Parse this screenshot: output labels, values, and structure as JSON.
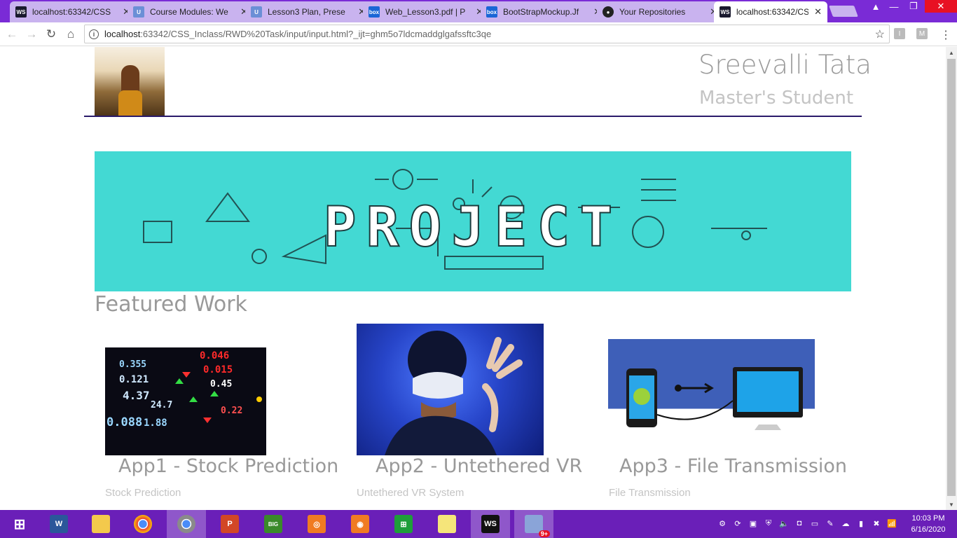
{
  "browser": {
    "tabs": [
      {
        "label": "localhost:63342/CSS",
        "favicon": "ws-icon",
        "favicon_color": "#1a1a2e",
        "active": false
      },
      {
        "label": "Course Modules: We",
        "favicon": "umkc-icon",
        "favicon_color": "#6b8fd6",
        "active": false
      },
      {
        "label": "Lesson3 Plan, Prese",
        "favicon": "umkc-icon",
        "favicon_color": "#6b8fd6",
        "active": false
      },
      {
        "label": "Web_Lesson3.pdf | P",
        "favicon": "box-icon",
        "favicon_color": "#1a66d6",
        "active": false
      },
      {
        "label": "BootStrapMockup.Jf",
        "favicon": "box-icon",
        "favicon_color": "#1a66d6",
        "active": false
      },
      {
        "label": "Your Repositories",
        "favicon": "github-icon",
        "favicon_color": "#222222",
        "active": false
      },
      {
        "label": "localhost:63342/CSS",
        "favicon": "ws-icon",
        "favicon_color": "#1a1a2e",
        "active": true
      }
    ],
    "close_glyph": "✕",
    "url_host": "localhost",
    "url_rest": ":63342/CSS_Inclass/RWD%20Task/input/input.html?_ijt=ghm5o7ldcmaddglgafssftc3qe",
    "extensions": [
      "I",
      "M"
    ]
  },
  "page": {
    "name": "Sreevalli Tata",
    "role": "Master's Student",
    "banner_text": "PROJECT",
    "featured_heading": "Featured Work",
    "cards": [
      {
        "title": "App1 - Stock Prediction",
        "subtitle": "Stock Prediction"
      },
      {
        "title": "App2 - Untethered VR",
        "subtitle": "Untethered VR System"
      },
      {
        "title": "App3 - File Transmission",
        "subtitle": "File Transmission"
      }
    ],
    "stock_numbers": [
      "0.046",
      "0.355",
      "0.015",
      "0.121",
      "0.45",
      "4.37",
      "24.7",
      "0.22",
      "0.088",
      "1.88"
    ]
  },
  "taskbar": {
    "apps": [
      "windows-start-icon",
      "word-icon",
      "file-explorer-icon",
      "chrome-icon",
      "chrome-alt-icon",
      "powerpoint-icon",
      "big-farm-icon",
      "photo-app-icon",
      "camera-icon",
      "store-icon",
      "sticky-notes-icon",
      "webstorm-icon",
      "mail-icon"
    ],
    "notification_badge": "9+",
    "time": "10:03 PM",
    "date": "6/16/2020"
  }
}
